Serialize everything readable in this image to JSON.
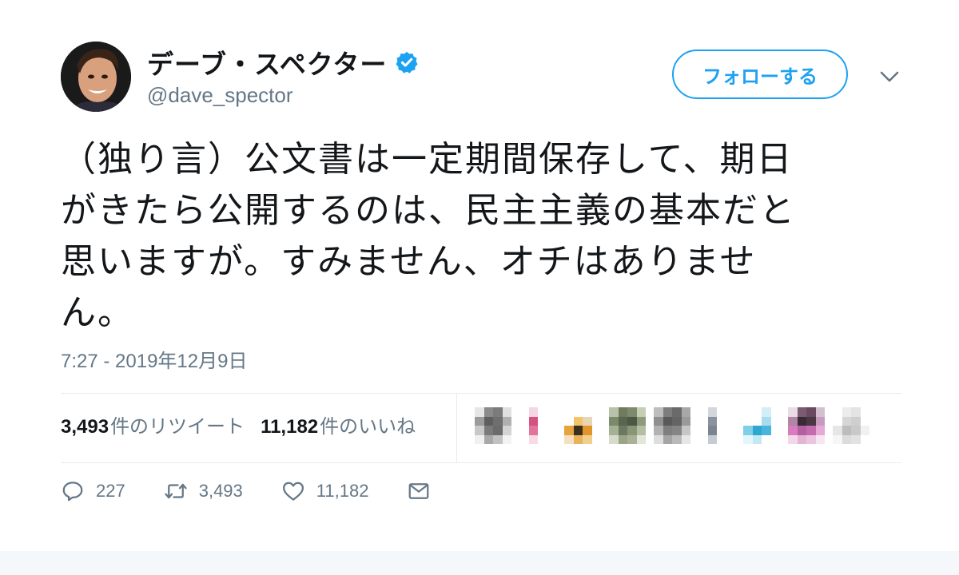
{
  "tweet": {
    "author": {
      "display_name": "デーブ・スペクター",
      "handle": "@dave_spector",
      "avatar_icon": "user-avatar-icon",
      "verified_icon": "verified-badge-icon"
    },
    "follow_button_label": "フォローする",
    "more_icon": "chevron-down-icon",
    "text_lines": [
      "（独り言）公文書は一定期間保存して、期日",
      "がきたら公開するのは、民主主義の基本だと",
      "思いますが。すみません、オチはありませ",
      "ん。"
    ],
    "timestamp": "7:27 - 2019年12月9日",
    "stats": {
      "retweets_count": "3,493",
      "retweets_label": "件のリツイート",
      "likes_count": "11,182",
      "likes_label": "件のいいね"
    },
    "actions": {
      "reply_count": "227",
      "retweet_count": "3,493",
      "like_count": "11,182",
      "reply_icon": "reply-icon",
      "retweet_icon": "retweet-icon",
      "like_icon": "heart-icon",
      "dm_icon": "envelope-icon"
    }
  },
  "colors": {
    "accent": "#1da1f2",
    "text": "#14171a",
    "secondary_text": "#657786",
    "divider": "#e6ecf0"
  }
}
